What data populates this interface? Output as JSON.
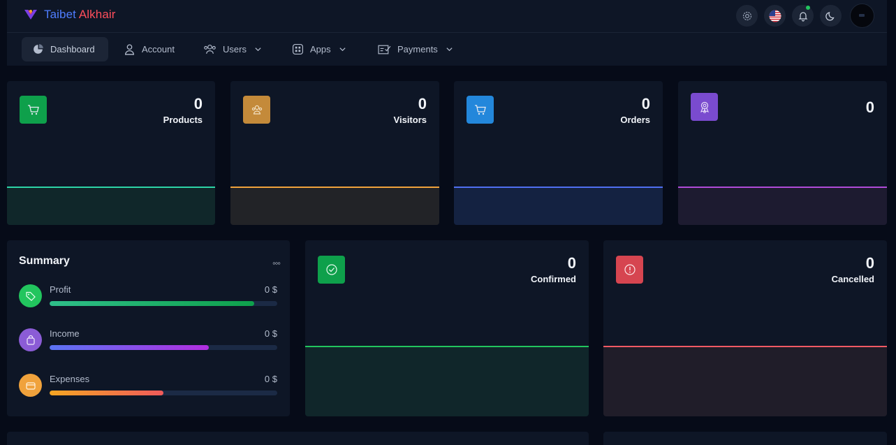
{
  "brand": {
    "name_part1": "Taibet",
    "name_part2": "Alkhair"
  },
  "nav": [
    {
      "label": "Dashboard",
      "active": true
    },
    {
      "label": "Account"
    },
    {
      "label": "Users"
    },
    {
      "label": "Apps"
    },
    {
      "label": "Payments"
    }
  ],
  "top_actions": [
    "gear-icon",
    "us-flag-icon",
    "bell-icon",
    "moon-icon"
  ],
  "stat_cards": [
    {
      "value": "0",
      "label": "Products",
      "color": "#0ea04b",
      "line": "#2dd4a6",
      "icon": "cart-icon"
    },
    {
      "value": "0",
      "label": "Visitors",
      "color": "#c48a3a",
      "line": "#f0a23c",
      "icon": "users-icon"
    },
    {
      "value": "0",
      "label": "Orders",
      "color": "#2387db",
      "line": "#4f6ff0",
      "icon": "cart-icon"
    },
    {
      "value": "0",
      "label": "",
      "color": "#7a4bcf",
      "line": "#b04bd8",
      "icon": "award-icon"
    }
  ],
  "summary": {
    "title": "Summary",
    "more": "◦◦◦",
    "rows": [
      {
        "name": "Profit",
        "value": "0 $",
        "progress": 0.9,
        "icon_color": "#22c55e",
        "bar": "linear-gradient(90deg,#2fbf8a,#0ea04b)",
        "icon": "tag-icon"
      },
      {
        "name": "Income",
        "value": "0 $",
        "progress": 0.7,
        "icon_color": "#8b5cd6",
        "bar": "linear-gradient(90deg,#5b74f4,#b12ee0)",
        "icon": "bag-icon"
      },
      {
        "name": "Expenses",
        "value": "0 $",
        "progress": 0.5,
        "icon_color": "#f0a23c",
        "bar": "linear-gradient(90deg,#f5a623,#f05a5a)",
        "icon": "wallet-icon"
      }
    ]
  },
  "status_cards": [
    {
      "value": "0",
      "label": "Confirmed",
      "color": "#0ea04b",
      "line": "#22c55e",
      "icon": "check-circle-icon"
    },
    {
      "value": "0",
      "label": "Cancelled",
      "color": "#d64550",
      "line": "#f05a64",
      "icon": "alert-circle-icon"
    }
  ]
}
